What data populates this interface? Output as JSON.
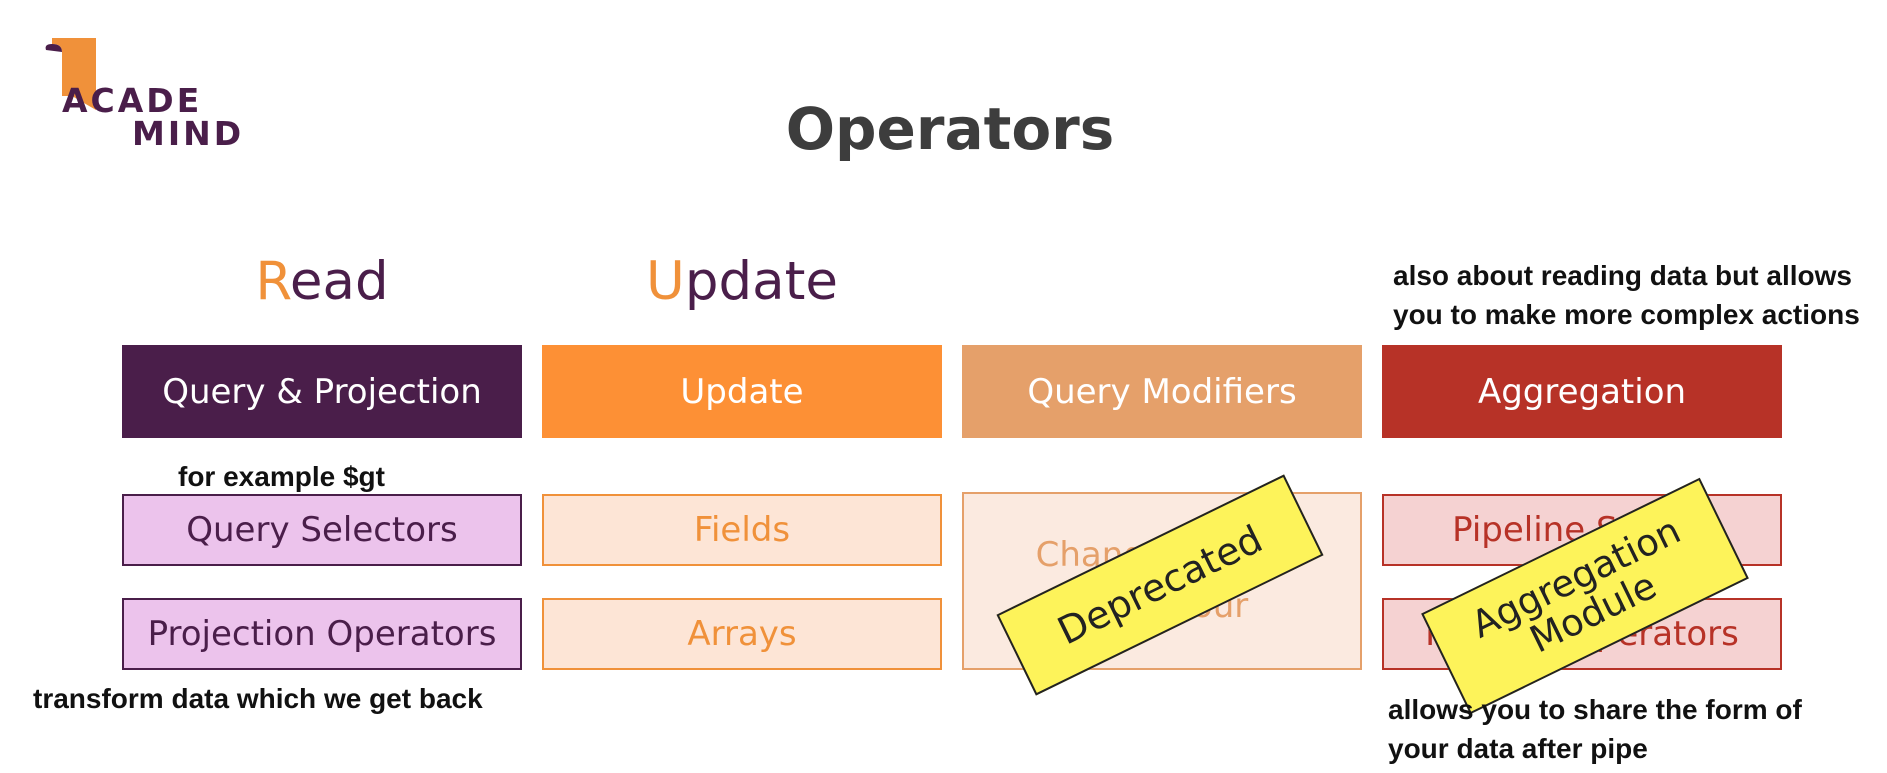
{
  "logo": {
    "line1": "ACADE",
    "line2": "MIND"
  },
  "title": "Operators",
  "sections": {
    "read": {
      "first_letter": "R",
      "rest": "ead"
    },
    "update": {
      "first_letter": "U",
      "rest": "pdate"
    }
  },
  "columns": [
    {
      "header": "Query & Projection",
      "color": "#4a1e4a",
      "items": [
        "Query Selectors",
        "Projection Operators"
      ],
      "item_bg": "#ecc3ec",
      "item_border": "#4a1e4a",
      "item_text": "#4a1e4a"
    },
    {
      "header": "Update",
      "color": "#fd9035",
      "items": [
        "Fields",
        "Arrays"
      ],
      "item_bg": "#fde5d6",
      "item_border": "#f0913a",
      "item_text": "#f0913a"
    },
    {
      "header": "Query Modifiers",
      "color": "#e5a06a",
      "items": [
        "Change Cursor Behaviour"
      ],
      "item_bg": "#fbeae0",
      "item_border": "#e5a06a",
      "item_text": "#e5a06a"
    },
    {
      "header": "Aggregation",
      "color": "#b73227",
      "items": [
        "Pipeline Stages",
        "Pipeline Operators"
      ],
      "item_bg": "#f5d2d2",
      "item_border": "#b73227",
      "item_text": "#b73227"
    }
  ],
  "stickers": {
    "deprecated": "Deprecated",
    "aggregation_line1": "Aggregation",
    "aggregation_line2": "Module"
  },
  "annotations": {
    "aggregation_top_line1": "also about reading data but allows",
    "aggregation_top_line2": "you to make more complex  actions",
    "query_selectors": "for example $gt",
    "projection": "transform data which we get back",
    "aggregation_bottom_line1": "allows you to share the form of",
    "aggregation_bottom_line2": "your data after pipe"
  },
  "colors": {
    "logo_flag": "#f0913a",
    "logo_text": "#4a1e4a",
    "sticker": "#fdf35a"
  }
}
